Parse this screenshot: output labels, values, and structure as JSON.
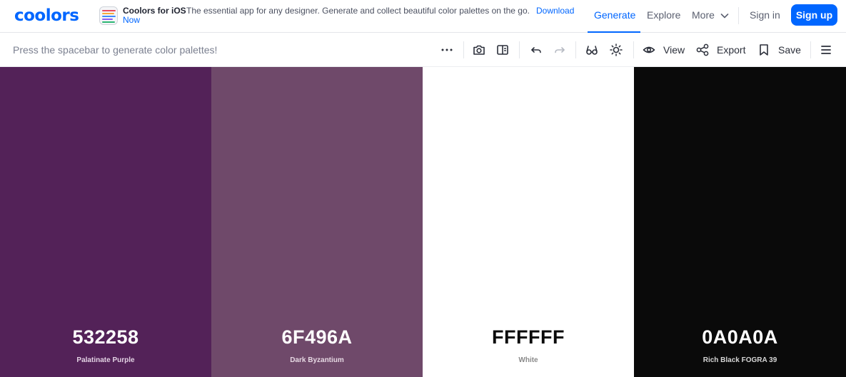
{
  "brand": {
    "logo_text": "coolors",
    "accent": "#0066ff"
  },
  "promo": {
    "title": "Coolors for iOS",
    "text": "The essential app for any designer. Generate and collect beautiful color palettes on the go.",
    "download_link": "Download",
    "download_link_2": "Now",
    "icon": "app-icon"
  },
  "nav": {
    "generate": "Generate",
    "explore": "Explore",
    "more": "More",
    "sign_in": "Sign in",
    "sign_up": "Sign up"
  },
  "toolbar": {
    "hint": "Press the spacebar to generate color palettes!",
    "view": "View",
    "export": "Export",
    "save": "Save",
    "icons": [
      "more-dots-icon",
      "camera-icon",
      "panel-icon",
      "undo-icon",
      "redo-icon",
      "glasses-icon",
      "sun-icon",
      "eye-icon",
      "share-icon",
      "bookmark-icon",
      "menu-icon"
    ]
  },
  "palette": [
    {
      "hex": "532258",
      "name": "Palatinate Purple",
      "color": "#532258",
      "text_color": "#ffffff",
      "name_color": "#e3d2e4"
    },
    {
      "hex": "6F496A",
      "name": "Dark Byzantium",
      "color": "#6f496a",
      "text_color": "#ffffff",
      "name_color": "#e6d8e3"
    },
    {
      "hex": "FFFFFF",
      "name": "White",
      "color": "#ffffff",
      "text_color": "#0a0a0a",
      "name_color": "#8a8a8a"
    },
    {
      "hex": "0A0A0A",
      "name": "Rich Black FOGRA 39",
      "color": "#0a0a0a",
      "text_color": "#ffffff",
      "name_color": "#d6d6d6"
    }
  ]
}
